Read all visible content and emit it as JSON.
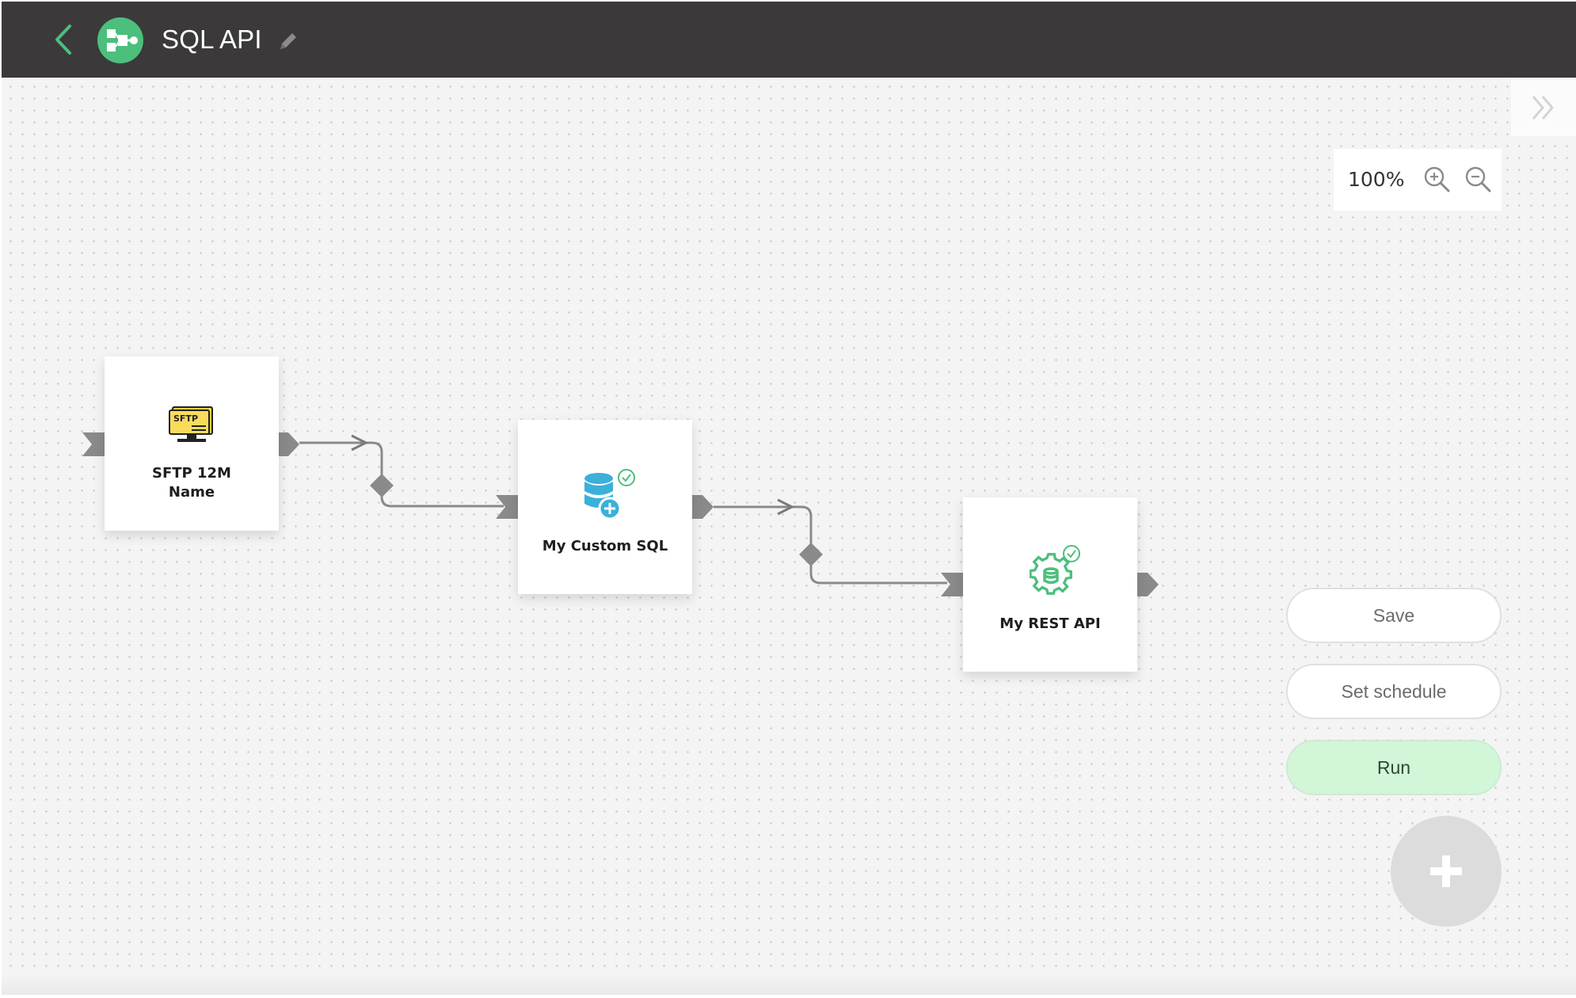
{
  "header": {
    "title": "SQL API",
    "back_icon": "chevron-left-icon",
    "logo_icon": "pipeline-flow-icon",
    "edit_icon": "pencil-icon"
  },
  "canvas": {
    "panel_toggle_icon": "double-chevron-right-icon",
    "zoom": {
      "level": "100%",
      "zoom_in_icon": "zoom-in-icon",
      "zoom_out_icon": "zoom-out-icon"
    }
  },
  "nodes": [
    {
      "id": "sftp",
      "label_line1": "SFTP 12M",
      "label_line2": "Name",
      "icon": "sftp-server-icon",
      "icon_text": "SFTP"
    },
    {
      "id": "custom-sql",
      "label": "My Custom SQL",
      "icon": "database-add-icon",
      "status_icon": "check-circle-icon"
    },
    {
      "id": "rest-api",
      "label": "My REST API",
      "icon": "gear-database-icon",
      "status_icon": "check-circle-icon"
    }
  ],
  "actions": {
    "save_label": "Save",
    "schedule_label": "Set schedule",
    "run_label": "Run",
    "add_icon": "plus-icon"
  },
  "colors": {
    "header_bg": "#3b393a",
    "accent_green": "#4cbf7c",
    "run_bg": "#d2f7d8",
    "connector_gray": "#8a8a8a",
    "sql_blue": "#3bb0d9",
    "sftp_yellow": "#f7d44a"
  }
}
